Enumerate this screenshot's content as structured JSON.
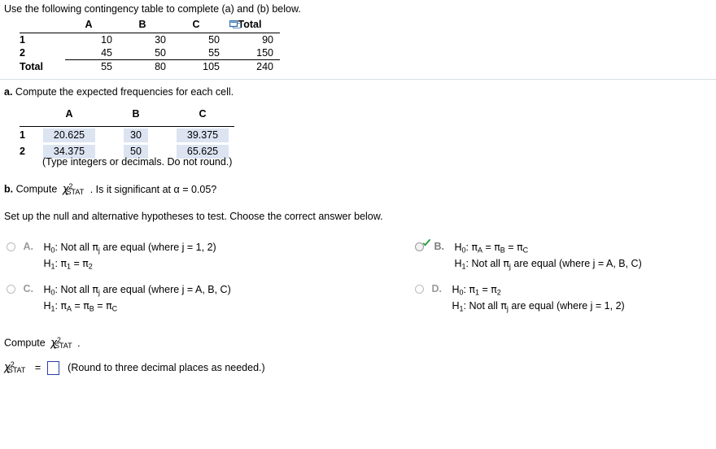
{
  "intro": {
    "text": "Use the following contingency table to complete (a) and (b) below."
  },
  "contingency_table": {
    "columns": [
      "A",
      "B",
      "C",
      "Total"
    ],
    "rows": [
      {
        "label": "1",
        "values": [
          "10",
          "30",
          "50",
          "90"
        ]
      },
      {
        "label": "2",
        "values": [
          "45",
          "50",
          "55",
          "150"
        ]
      },
      {
        "label": "Total",
        "values": [
          "55",
          "80",
          "105",
          "240"
        ]
      }
    ],
    "copy_icon": "copy-icon"
  },
  "part_a": {
    "label": "a.",
    "text": "Compute the expected frequencies for each cell.",
    "table": {
      "columns": [
        "A",
        "B",
        "C"
      ],
      "rows": [
        {
          "label": "1",
          "values": [
            "20.625",
            "30",
            "39.375"
          ]
        },
        {
          "label": "2",
          "values": [
            "34.375",
            "50",
            "65.625"
          ]
        }
      ]
    },
    "note": "(Type integers or decimals. Do not round.)"
  },
  "part_b": {
    "label": "b.",
    "text_before": "Compute",
    "statistic": "χ",
    "statistic_sup": "2",
    "statistic_sub": "STAT",
    "text_after": ". Is it significant at α = 0.05?",
    "instruction": "Set up the null and alternative hypotheses to test. Choose the correct answer below."
  },
  "choices": [
    {
      "letter": "A.",
      "selected": false,
      "line1": "H₀: Not all πⱼ are equal (where j = 1, 2)",
      "line2": "H₁: π₁ = π₂",
      "h0_label": "H",
      "h0_sub": "0",
      "h1_label": "H",
      "h1_sub": "1",
      "h0_body": "Not all πj are equal (where j = 1, 2)",
      "h1_body": "π1 = π2"
    },
    {
      "letter": "B.",
      "selected": true,
      "line1": "H₀: πₐ = πʙ = πꟲ",
      "line2": "H₁: Not all πⱼ are equal (where j = A, B, C)",
      "h0_label": "H",
      "h0_sub": "0",
      "h1_label": "H",
      "h1_sub": "1",
      "h0_body": "πA = πB = πC",
      "h1_body": "Not all πj are equal (where j = A, B, C)"
    },
    {
      "letter": "C.",
      "selected": false,
      "line1": "H₀: Not all πⱼ are equal (where j = A, B, C)",
      "line2": "H₁: πₐ = πʙ = πꟲ",
      "h0_label": "H",
      "h0_sub": "0",
      "h1_label": "H",
      "h1_sub": "1",
      "h0_body": "Not all πj are equal (where j = A, B, C)",
      "h1_body": "πA = πB = πC"
    },
    {
      "letter": "D.",
      "selected": false,
      "line1": "H₀: π₁ = π₂",
      "line2": "H₁: Not all πⱼ are equal (where j = 1, 2)",
      "h0_label": "H",
      "h0_sub": "0",
      "h1_label": "H",
      "h1_sub": "1",
      "h0_body": "π1 = π2",
      "h1_body": "Not all πj are equal (where j = 1, 2)"
    }
  ],
  "compute_section": {
    "prompt": "Compute",
    "statistic": "χ",
    "statistic_sup": "2",
    "statistic_sub": "STAT",
    "period": ".",
    "equals": "=",
    "answer_value": "",
    "hint": "(Round to three decimal places as needed.)"
  },
  "colors": {
    "answer_fill": "#dce4f2",
    "input_border": "#2b3ea8",
    "divider": "#d7dde4",
    "radio_grey": "#bcbcbc",
    "check_green": "#2e9b3f",
    "icon_blue": "#4a7ebb"
  }
}
